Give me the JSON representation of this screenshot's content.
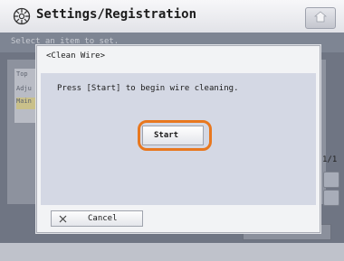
{
  "header": {
    "title": "Settings/Registration",
    "title_icon": "settings-gear-icon",
    "home_icon": "home-icon"
  },
  "background": {
    "instruction": "Select an item to set.",
    "list_items": [
      "Top",
      "Adju",
      "Main"
    ],
    "page_indicator": "1/1"
  },
  "dialog": {
    "title": "<Clean Wire>",
    "message": "Press [Start] to begin wire cleaning.",
    "start_label": "Start",
    "cancel_label": "Cancel",
    "highlight_color": "#e8781f"
  }
}
